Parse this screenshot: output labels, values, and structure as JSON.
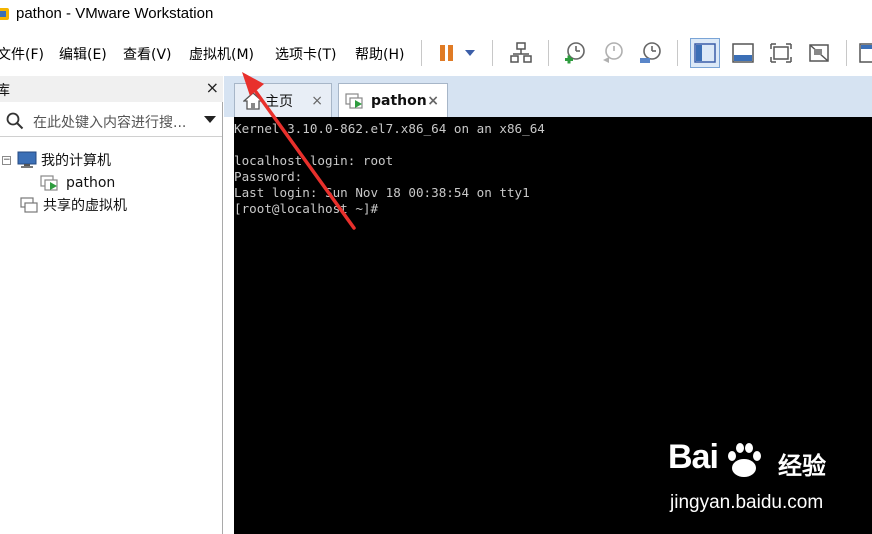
{
  "window": {
    "title": "pathon - VMware Workstation"
  },
  "menu": {
    "items": [
      {
        "label": "文件(F)"
      },
      {
        "label": "编辑(E)"
      },
      {
        "label": "查看(V)"
      },
      {
        "label": "虚拟机(M)"
      },
      {
        "label": "选项卡(T)"
      },
      {
        "label": "帮助(H)"
      }
    ]
  },
  "sidebar": {
    "title": "库",
    "close_glyph": "×",
    "search_placeholder": "在此处键入内容进行搜...",
    "tree": {
      "my_computer": "我的计算机",
      "vm": "pathon",
      "shared": "共享的虚拟机"
    }
  },
  "tabs": [
    {
      "label": "主页",
      "close": "×"
    },
    {
      "label": "pathon",
      "close": "×"
    }
  ],
  "console": {
    "lines": [
      "Kernel 3.10.0-862.el7.x86_64 on an x86_64",
      "",
      "localhost login: root",
      "Password:",
      "Last login: Sun Nov 18 00:38:54 on tty1",
      "[root@localhost ~]#"
    ]
  },
  "watermark": {
    "brand": "Bai",
    "brand_cn": "经验",
    "url": "jingyan.baidu.com"
  },
  "colors": {
    "accent": "#4a7ab7",
    "tabstrip": "#d6e3f2",
    "console_bg": "#000000",
    "annotation_arrow": "#e8302c"
  }
}
